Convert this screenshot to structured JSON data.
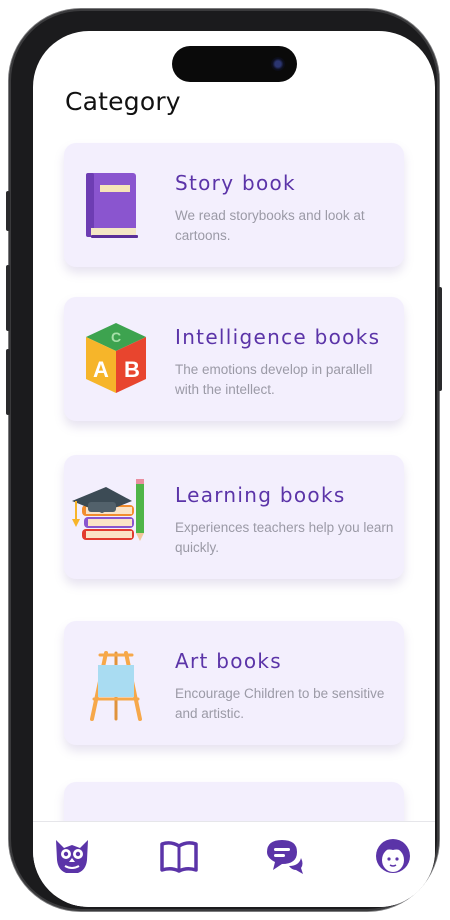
{
  "page": {
    "title": "Category"
  },
  "categories": [
    {
      "title": "Story book",
      "description": "We read storybooks and look at cartoons.",
      "icon": "book-icon"
    },
    {
      "title": "Intelligence books",
      "description": "The emotions develop in parallell with the intellect.",
      "icon": "abc-blocks-icon",
      "block_letters": [
        "C",
        "A",
        "B"
      ]
    },
    {
      "title": "Learning books",
      "description": "Experiences teachers help you learn quickly.",
      "icon": "graduation-books-icon"
    },
    {
      "title": "Art books",
      "description": "Encourage Children to be sensitive and artistic.",
      "icon": "easel-icon"
    }
  ],
  "tabbar": {
    "items": [
      {
        "icon": "owl-icon"
      },
      {
        "icon": "open-book-icon"
      },
      {
        "icon": "chat-icon"
      },
      {
        "icon": "profile-icon"
      }
    ]
  },
  "colors": {
    "accent": "#5b34a8",
    "card_background": "#f3effd",
    "description_text": "#9b9aa6"
  }
}
